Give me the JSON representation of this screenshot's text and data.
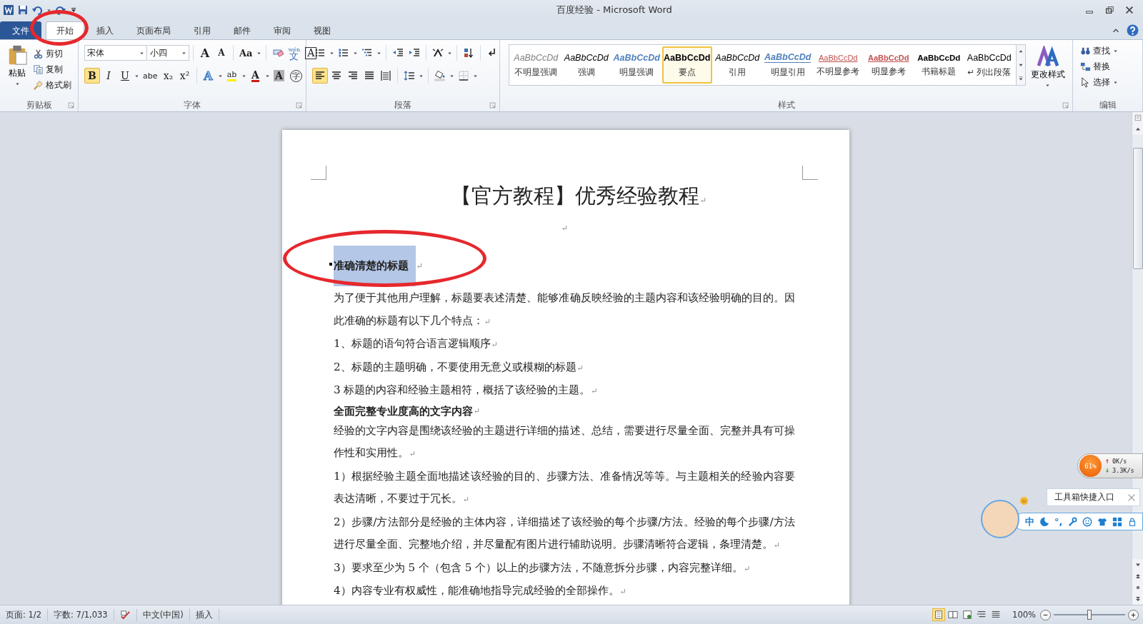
{
  "title_bar": {
    "title": "百度经验 - Microsoft Word"
  },
  "tabs": [
    {
      "label": "文件",
      "kind": "file",
      "selected": false,
      "circled": false
    },
    {
      "label": "开始",
      "kind": "tab",
      "selected": true,
      "circled": true
    },
    {
      "label": "插入",
      "kind": "tab",
      "selected": false,
      "circled": false
    },
    {
      "label": "页面布局",
      "kind": "tab",
      "selected": false,
      "circled": false
    },
    {
      "label": "引用",
      "kind": "tab",
      "selected": false,
      "circled": false
    },
    {
      "label": "邮件",
      "kind": "tab",
      "selected": false,
      "circled": false
    },
    {
      "label": "审阅",
      "kind": "tab",
      "selected": false,
      "circled": false
    },
    {
      "label": "视图",
      "kind": "tab",
      "selected": false,
      "circled": false
    }
  ],
  "ribbon": {
    "clipboard": {
      "label": "剪贴板",
      "launcher": true,
      "paste": "粘贴",
      "items": [
        {
          "kind": "cut",
          "text": "剪切"
        },
        {
          "kind": "copy",
          "text": "复制"
        },
        {
          "kind": "painter",
          "text": "格式刷"
        }
      ]
    },
    "font": {
      "label": "字体",
      "launcher": true,
      "row1": [
        [
          {
            "kind": "font-field",
            "value": "宋体"
          },
          {
            "kind": "size-field",
            "value": "小四"
          }
        ],
        [
          {
            "kind": "grow",
            "text": "A"
          },
          {
            "kind": "shrink",
            "text": "A"
          }
        ],
        [
          {
            "kind": "case",
            "text": "Aa",
            "dropdown": true
          }
        ],
        [
          {
            "kind": "clear"
          },
          {
            "kind": "phonetic",
            "ruby": "wén",
            "text": "文"
          },
          {
            "kind": "border",
            "text": "A"
          }
        ]
      ],
      "row2": [
        [
          {
            "kind": "bold",
            "text": "B",
            "on": true
          },
          {
            "kind": "italic",
            "text": "I",
            "on": false
          },
          {
            "kind": "underline",
            "text": "U",
            "on": false,
            "dropdown": true
          },
          {
            "kind": "strike",
            "text": "abe",
            "on": false
          },
          {
            "kind": "sub",
            "text": "x₂",
            "on": false
          },
          {
            "kind": "sup",
            "text": "x²",
            "on": false
          }
        ],
        [
          {
            "kind": "effects",
            "text": "A",
            "dropdown": true
          },
          {
            "kind": "highlight",
            "text": "ab",
            "dropdown": true
          },
          {
            "kind": "color",
            "text": "A",
            "dropdown": true
          },
          {
            "kind": "shading",
            "text": "A"
          },
          {
            "kind": "enclose",
            "text": "字"
          }
        ]
      ]
    },
    "paragraph": {
      "label": "段落",
      "launcher": true,
      "row1": [
        [
          {
            "kind": "bullets",
            "dropdown": true
          },
          {
            "kind": "numbering",
            "dropdown": true
          },
          {
            "kind": "multilevel",
            "dropdown": true
          }
        ],
        [
          {
            "kind": "outdent"
          },
          {
            "kind": "indent"
          }
        ],
        [
          {
            "kind": "asian-layout",
            "dropdown": true
          }
        ],
        [
          {
            "kind": "sort"
          }
        ],
        [
          {
            "kind": "marks"
          }
        ]
      ],
      "row2": [
        [
          {
            "kind": "align-left",
            "selected": true
          },
          {
            "kind": "align-center",
            "selected": false
          },
          {
            "kind": "align-right",
            "selected": false
          },
          {
            "kind": "justify",
            "selected": false
          },
          {
            "kind": "distributed",
            "selected": false
          }
        ],
        [
          {
            "kind": "line-spacing",
            "dropdown": true
          }
        ],
        [
          {
            "kind": "fill",
            "dropdown": true
          },
          {
            "kind": "borders",
            "dropdown": true
          }
        ]
      ]
    },
    "styles": {
      "label": "样式",
      "launcher": true,
      "change_styles": "更改样式",
      "gallery": [
        {
          "kind": "subtle-emphasis",
          "preview": "AaBbCcDd",
          "label": "不明显强调",
          "selected": false
        },
        {
          "kind": "emphasis",
          "preview": "AaBbCcDd",
          "label": "强调",
          "selected": false
        },
        {
          "kind": "intense-emphasis",
          "preview": "AaBbCcDd",
          "label": "明显强调",
          "selected": false
        },
        {
          "kind": "strong",
          "preview": "AaBbCcDd",
          "label": "要点",
          "selected": true
        },
        {
          "kind": "quote",
          "preview": "AaBbCcDd",
          "label": "引用",
          "selected": false
        },
        {
          "kind": "intense-quote",
          "preview": "AaBbCcDd",
          "label": "明显引用",
          "selected": false
        },
        {
          "kind": "subtle-reference",
          "preview": "AaBbCcDd",
          "label": "不明显参考",
          "selected": false
        },
        {
          "kind": "intense-reference",
          "preview": "AaBbCcDd",
          "label": "明显参考",
          "selected": false
        },
        {
          "kind": "book-title",
          "preview": "AaBbCcDd",
          "label": "书籍标题",
          "selected": false
        },
        {
          "kind": "list-paragraph",
          "preview": "AaBbCcDd",
          "label": "↵ 列出段落",
          "selected": false
        }
      ]
    },
    "editing": {
      "label": "编辑",
      "launcher": false,
      "items": [
        {
          "kind": "find",
          "text": "查找",
          "dropdown": true
        },
        {
          "kind": "replace",
          "text": "替换",
          "dropdown": false
        },
        {
          "kind": "select",
          "text": "选择",
          "dropdown": true
        }
      ]
    }
  },
  "document": {
    "paragraphs": [
      {
        "kind": "title",
        "text": "【官方教程】优秀经验教程",
        "end_mark": "↵",
        "selected": false
      },
      {
        "kind": "empty",
        "end_mark": "↵",
        "selected": false
      },
      {
        "kind": "heading",
        "text": "准确清楚的标题",
        "end_mark": "↵",
        "format_mark": true,
        "selected": true,
        "circled": true
      },
      {
        "kind": "body",
        "text": "为了便于其他用户理解，标题要表述清楚、能够准确反映经验的主题内容和该经验明确的目的。因此准确的标题有以下几个特点：",
        "end_mark": "↵",
        "selected": false
      },
      {
        "kind": "body",
        "text": "1、标题的语句符合语言逻辑顺序",
        "end_mark": "↵",
        "selected": false
      },
      {
        "kind": "body",
        "text": "2、标题的主题明确，不要使用无意义或模糊的标题",
        "end_mark": "↵",
        "selected": false
      },
      {
        "kind": "body",
        "text": "3 标题的内容和经验主题相符，概括了该经验的主题。",
        "end_mark": "↵",
        "selected": false
      },
      {
        "kind": "heading",
        "text": "全面完整专业度高的文字内容",
        "end_mark": "↵",
        "format_mark": false,
        "selected": false,
        "circled": false
      },
      {
        "kind": "body",
        "text": "经验的文字内容是围绕该经验的主题进行详细的描述、总结，需要进行尽量全面、完整并具有可操作性和实用性。",
        "end_mark": "↵",
        "selected": false
      },
      {
        "kind": "body",
        "text": "1）根据经验主题全面地描述该经验的目的、步骤方法、准备情况等等。与主题相关的经验内容要表达清晰，不要过于冗长。",
        "end_mark": "↵",
        "selected": false
      },
      {
        "kind": "body",
        "text": "2）步骤/方法部分是经验的主体内容，详细描述了该经验的每个步骤/方法。经验的每个步骤/方法进行尽量全面、完整地介绍，并尽量配有图片进行辅助说明。步骤清晰符合逻辑，条理清楚。",
        "end_mark": "↵",
        "selected": false
      },
      {
        "kind": "body",
        "text": "3）要求至少为 5 个（包含 5 个）以上的步骤方法，不随意拆分步骤，内容完整详细。",
        "end_mark": "↵",
        "selected": false
      },
      {
        "kind": "body",
        "text": "4）内容专业有权威性，能准确地指导完成经验的全部操作。",
        "end_mark": "↵",
        "selected": false
      }
    ]
  },
  "status_bar": {
    "items": [
      {
        "kind": "text",
        "text": "页面: 1/2"
      },
      {
        "kind": "text",
        "text": "字数: 7/1,033"
      },
      {
        "kind": "spellcheck"
      },
      {
        "kind": "text",
        "text": "中文(中国)"
      },
      {
        "kind": "text",
        "text": "插入"
      }
    ],
    "views": [
      {
        "kind": "print",
        "selected": true
      },
      {
        "kind": "reading",
        "selected": false
      },
      {
        "kind": "web",
        "selected": false
      },
      {
        "kind": "outline",
        "selected": false
      },
      {
        "kind": "draft",
        "selected": false
      }
    ],
    "zoom": "100%",
    "zoom_slider": {
      "level": 0.5
    }
  },
  "network_meter": {
    "percent": "61%",
    "upload": "0K/s",
    "download": "3.3K/s"
  },
  "toolbox_tip": {
    "text": "工具箱快捷入口"
  },
  "ime_bar": {
    "items": [
      {
        "kind": "text",
        "text": "中"
      },
      {
        "kind": "moon"
      },
      {
        "kind": "text",
        "text": "°,"
      },
      {
        "kind": "wrench"
      },
      {
        "kind": "smiley"
      },
      {
        "kind": "shirt"
      },
      {
        "kind": "grid"
      },
      {
        "kind": "lock"
      }
    ]
  }
}
